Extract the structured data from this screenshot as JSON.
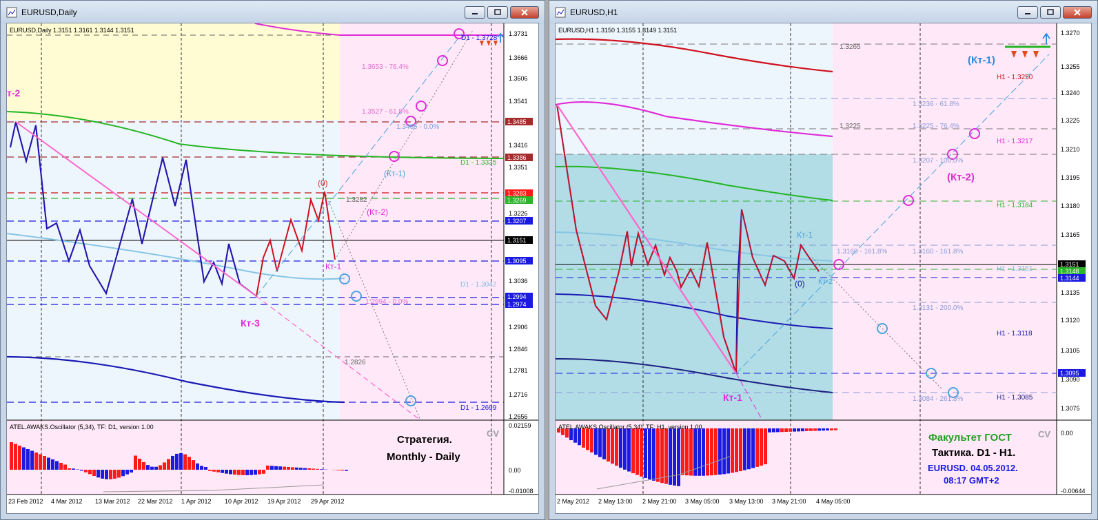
{
  "colors": {
    "red": "#d0101e",
    "blue": "#1a1ab4",
    "pink": "#ff66cc",
    "magenta": "#e02bd8",
    "green": "#23b523",
    "lightblue": "#86c5e4",
    "navy": "#1a2080",
    "darkred": "#8e1a1a"
  },
  "left_window": {
    "title": "EURUSD,Daily",
    "chart_header": "EURUSD,Daily  1.3151 1.3161 1.3144 1.3151",
    "price_axis_labels": [
      "1.3731",
      "1.3666",
      "1.3606",
      "1.3541",
      "1.3416",
      "1.3351",
      "1.3226",
      "1.3036",
      "1.2906",
      "1.2846",
      "1.2781",
      "1.2716",
      "1.2656"
    ],
    "price_tags": [
      {
        "text": "1.3485",
        "color": "#a52a2a"
      },
      {
        "text": "1.3386",
        "color": "#a52a2a"
      },
      {
        "text": "1.3283",
        "color": "#ff1a1a"
      },
      {
        "text": "1.3269",
        "color": "#2ab52a"
      },
      {
        "text": "1.3207",
        "color": "#1a1ae0"
      },
      {
        "text": "1.3151",
        "color": "#000000"
      },
      {
        "text": "1.3095",
        "color": "#1a1ae0"
      },
      {
        "text": "1.2994",
        "color": "#1a1ae0"
      },
      {
        "text": "1.2974",
        "color": "#1a1ae0"
      }
    ],
    "annotations": {
      "d1_top": "D1 - 1.3728",
      "fib_764": "1.3653 - 76.4%",
      "fib_618": "1.3527 - 61.8%",
      "fib_00_top": "1.3465 - 0.0%",
      "d1_green": "D1 - 1.3335",
      "kt1": "(Кт-1)",
      "kt2": "(Кт-2)",
      "zero": "(0)",
      "level_3282": "1.3282",
      "kt1_plain": "Кт-1",
      "d1_lightblue": "D1 - 1.3042",
      "fib_00_low": "1.2994 - 0.0%",
      "kt3": "Кт-3",
      "kt2_left": "т-2",
      "level_2826": "1.2826",
      "d1_blue": "D1 - 1.2699"
    },
    "oscillator_header": "ATEL.AWAKS.Oscillator (5,34), TF: D1,  version 1.00",
    "oscillator_axis": [
      "0.02159",
      "0.00",
      "-0.01008"
    ],
    "cv": "CV",
    "strategy_line1": "Стратегия.",
    "strategy_line2": "Monthly - Daily",
    "time_axis": [
      "23 Feb 2012",
      "4 Mar 2012",
      "13 Mar 2012",
      "22 Mar 2012",
      "1 Apr 2012",
      "10 Apr 2012",
      "19 Apr 2012",
      "29 Apr 2012"
    ]
  },
  "right_window": {
    "title": "EURUSD,H1",
    "chart_header": "EURUSD,H1  1.3150 1.3155 1.3149 1.3151",
    "price_axis_labels": [
      "1.3270",
      "1.3255",
      "1.3240",
      "1.3225",
      "1.3210",
      "1.3195",
      "1.3180",
      "1.3165",
      "1.3135",
      "1.3120",
      "1.3105",
      "1.3090",
      "1.3075"
    ],
    "price_tags": [
      {
        "text": "1.3151",
        "color": "#000000"
      },
      {
        "text": "1.3148",
        "color": "#2ab52a"
      },
      {
        "text": "1.3144",
        "color": "#1a1ae0"
      },
      {
        "text": "1.3095",
        "color": "#1a1ae0"
      }
    ],
    "annotations": {
      "level_3265": "1.3265",
      "kt1_big": "(Кт-1)",
      "h1_red": "H1 - 1.3250",
      "fib_618": "1.3236 - 61.8%",
      "level_3225": "1.3225",
      "fib_764": "1.3225 - 76.4%",
      "h1_magenta": "H1 - 1.3217",
      "fib_100": "1.3207 - 100.0%",
      "kt2_big": "(Кт-2)",
      "h1_green": "H1 - 1.3184",
      "kt1_small": "Кт-1",
      "fib_1618_a": "1.3160 - 161.8%",
      "fib_1618_b": "1.3160 - 161.8%",
      "h1_lightblue": "H1 - 1.3151",
      "zero": "(0)",
      "kt2_small": "Кт-2",
      "fib_200": "1.3131 - 200.0%",
      "h1_blue": "H1 - 1.3118",
      "fib_2618": "1.3084 - 261.8%",
      "h1_navy": "H1 - 1.3085",
      "kt1_bottom": "Кт-1"
    },
    "oscillator_header": "ATEL.AWAKS.Oscillator (5,34), TF: H1,  version 1.00",
    "oscillator_axis": [
      "0.00",
      "-0.00644"
    ],
    "cv": "CV",
    "faculty": "Факультет ГОСТ",
    "tactic": "Тактика. D1 - H1.",
    "pair_date": "EURUSD. 04.05.2012.",
    "time": "08:17  GMT+2",
    "time_axis": [
      "2 May 2012",
      "2 May 13:00",
      "2 May 21:00",
      "3 May 05:00",
      "3 May 13:00",
      "3 May 21:00",
      "4 May 05:00"
    ]
  }
}
